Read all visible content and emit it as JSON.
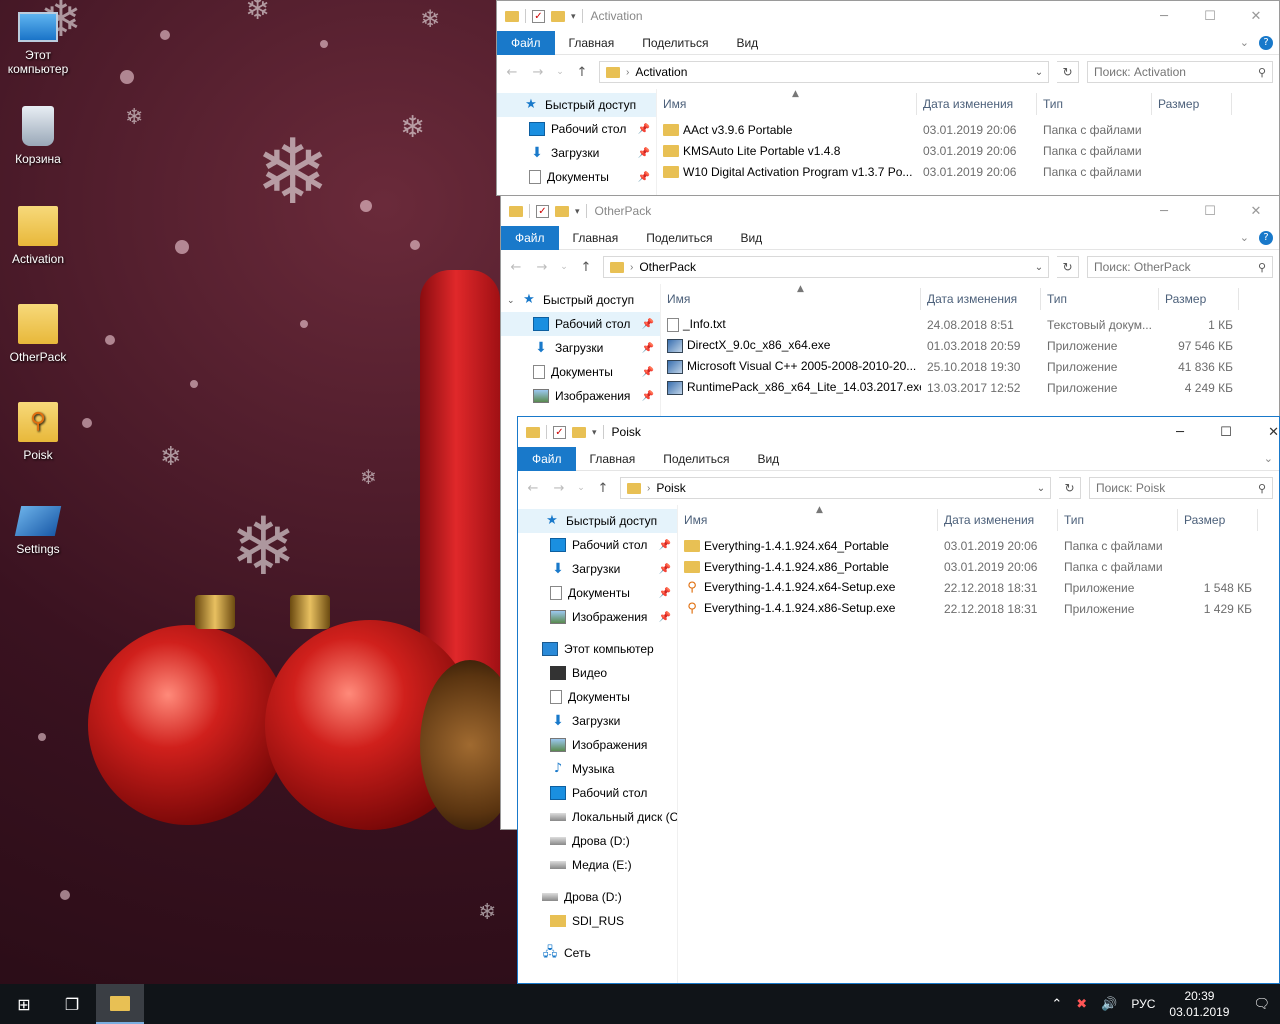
{
  "desktop": {
    "icons": [
      {
        "label_line1": "Этот",
        "label_line2": "компьютер",
        "icon": "computer-icon"
      },
      {
        "label": "Корзина",
        "icon": "recycle-bin-icon"
      },
      {
        "label": "Activation",
        "icon": "folder-icon"
      },
      {
        "label": "OtherPack",
        "icon": "folder-icon"
      },
      {
        "label": "Poisk",
        "icon": "search-app-icon"
      },
      {
        "label": "Settings",
        "icon": "settings-shortcut-icon"
      }
    ]
  },
  "ribbon": {
    "file": "Файл",
    "home": "Главная",
    "share": "Поделиться",
    "view": "Вид"
  },
  "columns": {
    "name": "Имя",
    "date": "Дата изменения",
    "type": "Тип",
    "size": "Размер"
  },
  "windows": {
    "activation": {
      "title": "Activation",
      "address": "Activation",
      "search_placeholder": "Поиск: Activation",
      "nav": [
        {
          "label": "Быстрый доступ",
          "icon": "star-icon"
        },
        {
          "label": "Рабочий стол",
          "icon": "desktop-icon"
        },
        {
          "label": "Загрузки",
          "icon": "downloads-icon"
        },
        {
          "label": "Документы",
          "icon": "documents-icon"
        }
      ],
      "rows": [
        {
          "name": "AAct v3.9.6 Portable",
          "date": "03.01.2019 20:06",
          "type": "Папка с файлами",
          "size": "",
          "icon": "folder"
        },
        {
          "name": "KMSAuto Lite Portable v1.4.8",
          "date": "03.01.2019 20:06",
          "type": "Папка с файлами",
          "size": "",
          "icon": "folder"
        },
        {
          "name": "W10 Digital Activation Program v1.3.7 Po...",
          "date": "03.01.2019 20:06",
          "type": "Папка с файлами",
          "size": "",
          "icon": "folder"
        }
      ]
    },
    "otherpack": {
      "title": "OtherPack",
      "address": "OtherPack",
      "search_placeholder": "Поиск: OtherPack",
      "nav": [
        {
          "label": "Быстрый доступ",
          "icon": "star-icon"
        },
        {
          "label": "Рабочий стол",
          "icon": "desktop-icon"
        },
        {
          "label": "Загрузки",
          "icon": "downloads-icon"
        },
        {
          "label": "Документы",
          "icon": "documents-icon"
        },
        {
          "label": "Изображения",
          "icon": "pictures-icon"
        }
      ],
      "rows": [
        {
          "name": "_Info.txt",
          "date": "24.08.2018 8:51",
          "type": "Текстовый докум...",
          "size": "1 КБ",
          "icon": "txt"
        },
        {
          "name": "DirectX_9.0c_x86_x64.exe",
          "date": "01.03.2018 20:59",
          "type": "Приложение",
          "size": "97 546 КБ",
          "icon": "exe"
        },
        {
          "name": "Microsoft Visual C++ 2005-2008-2010-20...",
          "date": "25.10.2018 19:30",
          "type": "Приложение",
          "size": "41 836 КБ",
          "icon": "exe"
        },
        {
          "name": "RuntimePack_x86_x64_Lite_14.03.2017.exe",
          "date": "13.03.2017 12:52",
          "type": "Приложение",
          "size": "4 249 КБ",
          "icon": "exe"
        }
      ]
    },
    "poisk": {
      "title": "Poisk",
      "address": "Poisk",
      "search_placeholder": "Поиск: Poisk",
      "nav": [
        {
          "label": "Быстрый доступ",
          "icon": "star-icon",
          "pin": false
        },
        {
          "label": "Рабочий стол",
          "icon": "desktop-icon",
          "pin": true
        },
        {
          "label": "Загрузки",
          "icon": "downloads-icon",
          "pin": true
        },
        {
          "label": "Документы",
          "icon": "documents-icon",
          "pin": true
        },
        {
          "label": "Изображения",
          "icon": "pictures-icon",
          "pin": true
        },
        {
          "label": "",
          "icon": "",
          "pin": false
        },
        {
          "label": "Этот компьютер",
          "icon": "computer-icon",
          "pin": false
        },
        {
          "label": "Видео",
          "icon": "video-icon",
          "pin": false
        },
        {
          "label": "Документы",
          "icon": "documents-icon",
          "pin": false
        },
        {
          "label": "Загрузки",
          "icon": "downloads-icon",
          "pin": false
        },
        {
          "label": "Изображения",
          "icon": "pictures-icon",
          "pin": false
        },
        {
          "label": "Музыка",
          "icon": "music-icon",
          "pin": false
        },
        {
          "label": "Рабочий стол",
          "icon": "desktop-icon",
          "pin": false
        },
        {
          "label": "Локальный диск (C",
          "icon": "drive-icon",
          "pin": false
        },
        {
          "label": "Дрова (D:)",
          "icon": "drive-icon",
          "pin": false
        },
        {
          "label": "Медиа (E:)",
          "icon": "drive-icon",
          "pin": false
        },
        {
          "label": "",
          "icon": "",
          "pin": false
        },
        {
          "label": "Дрова (D:)",
          "icon": "drive-icon",
          "pin": false
        },
        {
          "label": "SDI_RUS",
          "icon": "folder-icon",
          "pin": false
        },
        {
          "label": "",
          "icon": "",
          "pin": false
        },
        {
          "label": "Сеть",
          "icon": "network-icon",
          "pin": false
        }
      ],
      "rows": [
        {
          "name": "Everything-1.4.1.924.x64_Portable",
          "date": "03.01.2019 20:06",
          "type": "Папка с файлами",
          "size": "",
          "icon": "folder"
        },
        {
          "name": "Everything-1.4.1.924.x86_Portable",
          "date": "03.01.2019 20:06",
          "type": "Папка с файлами",
          "size": "",
          "icon": "folder"
        },
        {
          "name": "Everything-1.4.1.924.x64-Setup.exe",
          "date": "22.12.2018 18:31",
          "type": "Приложение",
          "size": "1 548 КБ",
          "icon": "eve"
        },
        {
          "name": "Everything-1.4.1.924.x86-Setup.exe",
          "date": "22.12.2018 18:31",
          "type": "Приложение",
          "size": "1 429 КБ",
          "icon": "eve"
        }
      ]
    }
  },
  "taskbar": {
    "language": "РУС",
    "time": "20:39",
    "date": "03.01.2019"
  }
}
